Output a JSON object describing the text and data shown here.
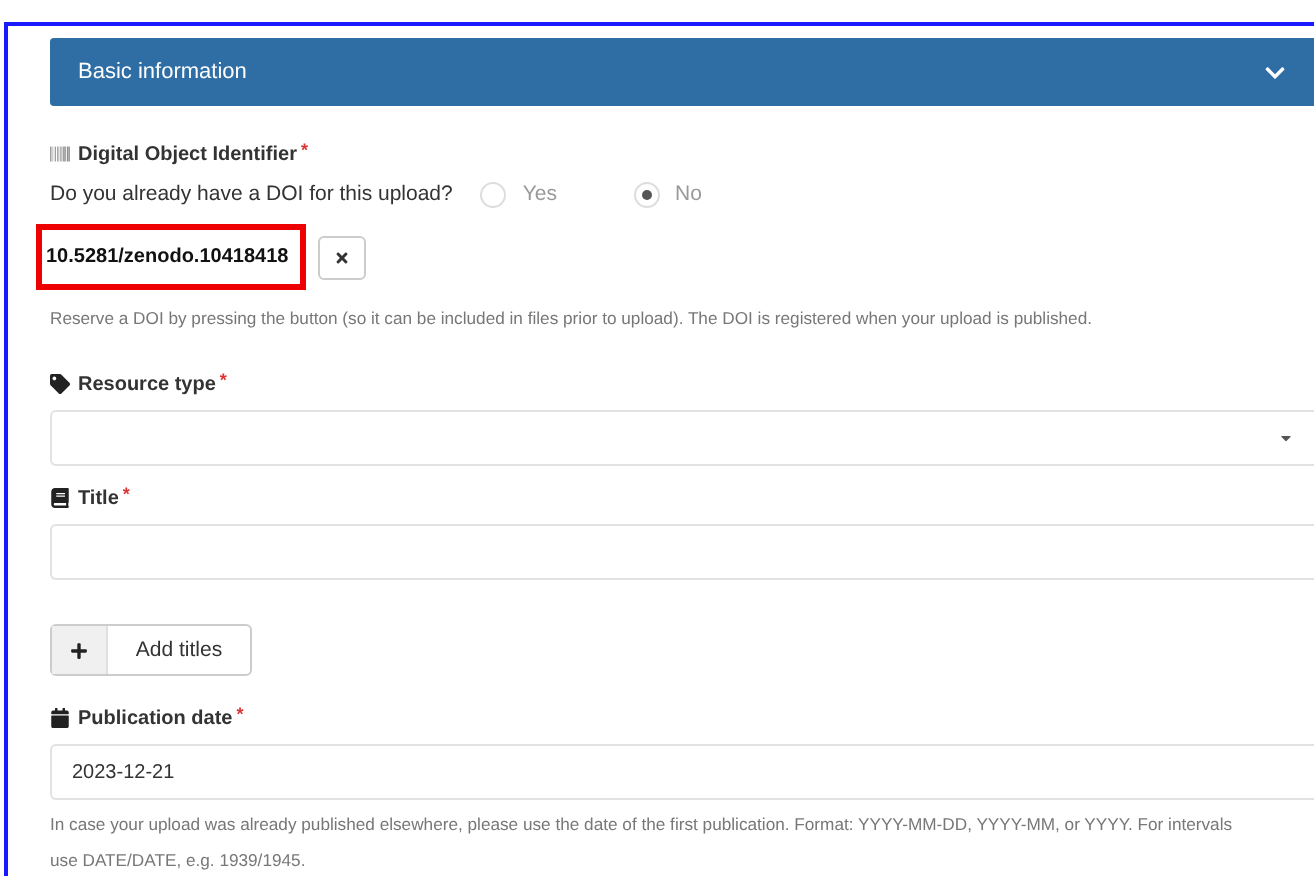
{
  "panel": {
    "title": "Basic information",
    "expanded": true
  },
  "doi": {
    "label": "Digital Object Identifier",
    "required_mark": "*",
    "question": "Do you already have a DOI for this upload?",
    "options": [
      {
        "label": "Yes",
        "selected": false
      },
      {
        "label": "No",
        "selected": true
      }
    ],
    "value": "10.5281/zenodo.10418418",
    "highlighted": true,
    "help": "Reserve a DOI by pressing the button (so it can be included in files prior to upload). The DOI is registered when your upload is published."
  },
  "fields": [
    {
      "kind": "select",
      "label": "Resource type",
      "required_mark": "*"
    },
    {
      "kind": "input",
      "label": "Title",
      "required_mark": "*"
    },
    {
      "kind": "button",
      "label": "Add titles"
    },
    {
      "kind": "date",
      "label": "Publication date",
      "required_mark": "*",
      "value": "2023-12-21",
      "help": "In case your upload was already published elsewhere, please use the date of the first publication. Format: YYYY-MM-DD, YYYY-MM, or YYYY. For intervals use DATE/DATE, e.g. 1939/1945."
    }
  ]
}
